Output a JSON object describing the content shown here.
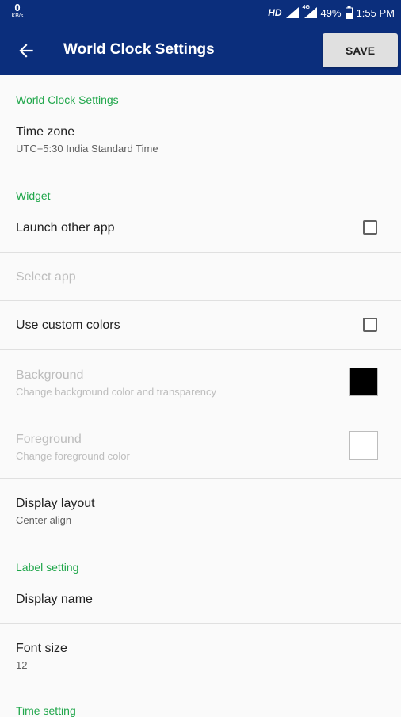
{
  "status_bar": {
    "net_speed": "0",
    "net_unit": "KB/s",
    "hd": "HD",
    "network": "4G",
    "battery": "49%",
    "time": "1:55 PM"
  },
  "app_bar": {
    "title": "World Clock Settings",
    "save_label": "SAVE",
    "back_icon": "arrow-left-icon"
  },
  "sections": {
    "world_clock": "World Clock Settings",
    "widget": "Widget",
    "label": "Label setting",
    "time": "Time setting"
  },
  "rows": {
    "time_zone": {
      "title": "Time zone",
      "summary": "UTC+5:30 India Standard Time"
    },
    "launch_other_app": {
      "title": "Launch other app",
      "checked": false
    },
    "select_app": {
      "title": "Select app",
      "enabled": false
    },
    "use_custom_colors": {
      "title": "Use custom colors",
      "checked": false
    },
    "background": {
      "title": "Background",
      "summary": "Change background color and transparency",
      "color": "#000000",
      "enabled": false
    },
    "foreground": {
      "title": "Foreground",
      "summary": "Change foreground color",
      "color": "#ffffff",
      "enabled": false
    },
    "display_layout": {
      "title": "Display layout",
      "summary": "Center align"
    },
    "display_name": {
      "title": "Display name"
    },
    "font_size": {
      "title": "Font size",
      "summary": "12"
    }
  },
  "colors": {
    "primary": "#0b2e7c",
    "section_accent": "#1fa64a",
    "disabled_text": "#bdbdbd"
  }
}
